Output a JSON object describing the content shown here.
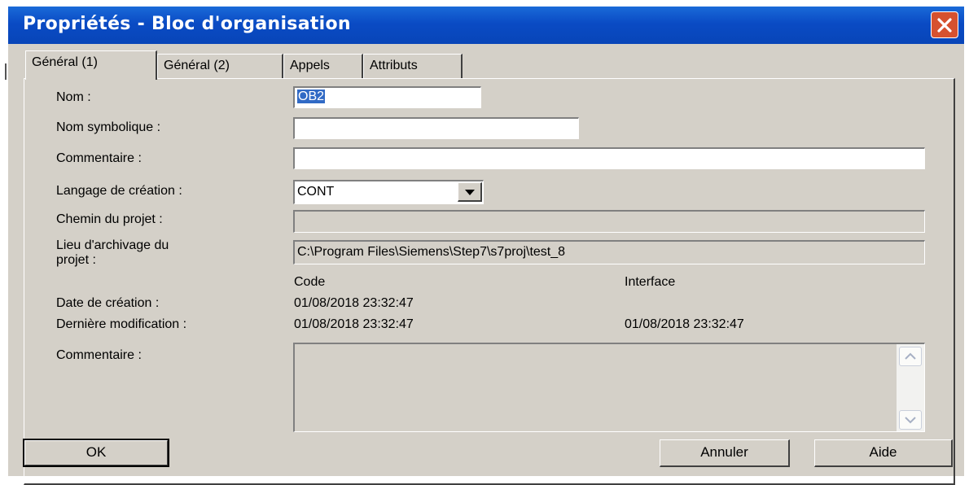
{
  "window": {
    "title": "Propriétés - Bloc d'organisation"
  },
  "tabs": [
    {
      "label": "Général (1)",
      "active": true
    },
    {
      "label": "Général (2)",
      "active": false
    },
    {
      "label": "Appels",
      "active": false
    },
    {
      "label": "Attributs",
      "active": false
    }
  ],
  "form": {
    "nom_label": "Nom :",
    "nom_value": "OB2",
    "nom_symbolique_label": "Nom symbolique :",
    "nom_symbolique_value": "",
    "commentaire_label": "Commentaire :",
    "commentaire_value": "",
    "langage_label": "Langage de création :",
    "langage_value": "CONT",
    "chemin_label": "Chemin du projet :",
    "chemin_value": "",
    "lieu_label_line1": "Lieu  d'archivage du",
    "lieu_label_line2": "projet :",
    "lieu_value": "C:\\Program Files\\Siemens\\Step7\\s7proj\\test_8",
    "col_code": "Code",
    "col_interface": "Interface",
    "date_creation_label": "Date de création :",
    "date_creation_code": "01/08/2018 23:32:47",
    "derniere_modif_label": "Dernière modification :",
    "derniere_modif_code": "01/08/2018 23:32:47",
    "derniere_modif_interface": "01/08/2018 23:32:47",
    "commentaire2_label": "Commentaire :",
    "commentaire2_value": ""
  },
  "buttons": {
    "ok": "OK",
    "annuler": "Annuler",
    "aide": "Aide"
  },
  "icons": {
    "close": "close-icon",
    "combo": "chevron-down-icon",
    "scroll_up": "scroll-up-icon",
    "scroll_down": "scroll-down-icon"
  },
  "colors": {
    "titlebar": "#0a4bc4",
    "close_button": "#d6512f",
    "dialog_face": "#d4d0c8",
    "selection": "#316ac5"
  }
}
